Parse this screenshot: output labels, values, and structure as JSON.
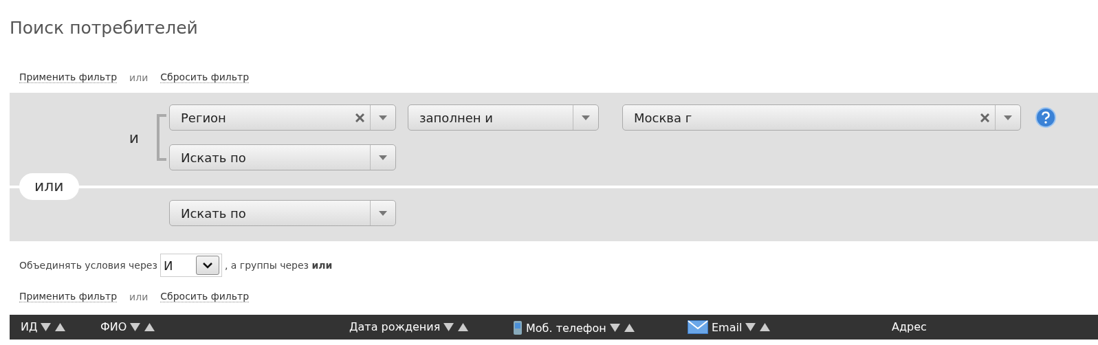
{
  "title": "Поиск потребителей",
  "top_actions": {
    "apply": "Применить фильтр",
    "separator": "или",
    "reset": "Сбросить фильтр"
  },
  "group_separator": "или",
  "groups": [
    {
      "conjunction": "и",
      "conditions": [
        {
          "kind": "condition",
          "field": {
            "value": "Регион",
            "clearable": true
          },
          "operator": {
            "value": "заполнен и"
          },
          "value": {
            "value": "Москва г",
            "clearable": true
          }
        },
        {
          "kind": "empty",
          "field": {
            "value": "Искать по",
            "clearable": false
          }
        }
      ]
    },
    {
      "conditions": [
        {
          "kind": "empty",
          "field": {
            "value": "Искать по",
            "clearable": false
          }
        }
      ]
    }
  ],
  "combine": {
    "prefix": "Объединять условия через",
    "select_value": "И",
    "suffix": ", а группы через **или**"
  },
  "bottom_actions": {
    "apply": "Применить фильтр",
    "separator": "или",
    "reset": "Сбросить фильтр"
  },
  "table": {
    "columns": [
      {
        "label": "ИД",
        "kind": "plain",
        "sortable": true
      },
      {
        "label": "ФИО",
        "kind": "plain",
        "sortable": true
      },
      {
        "label": "Дата рождения",
        "kind": "plain",
        "sortable": true
      },
      {
        "label": "Моб. телефон",
        "kind": "phone",
        "sortable": true
      },
      {
        "label": "Email",
        "kind": "email",
        "sortable": true
      },
      {
        "label": "Адрес",
        "kind": "plain",
        "sortable": false
      }
    ]
  }
}
